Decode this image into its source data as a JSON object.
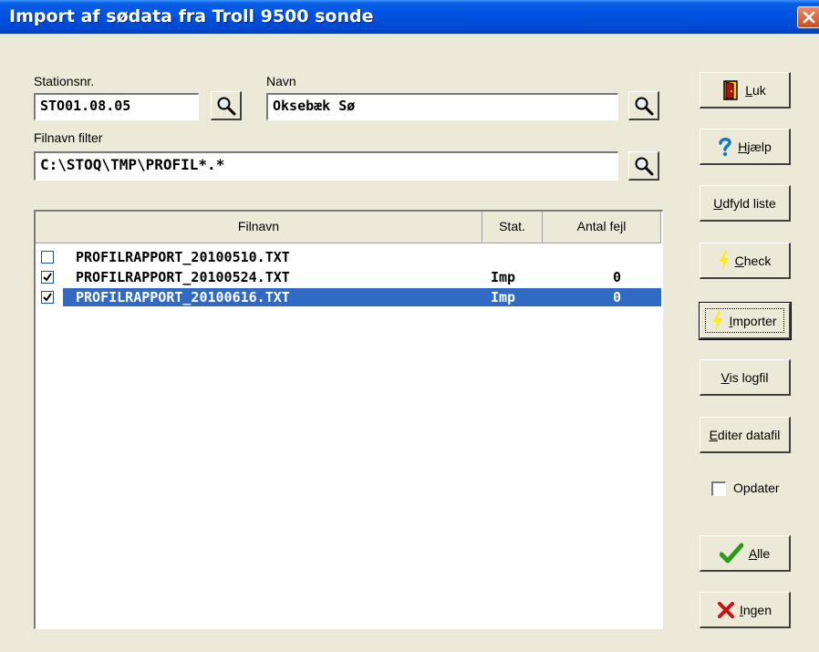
{
  "window": {
    "title": "Import af sødata fra Troll 9500 sonde"
  },
  "station": {
    "label": "Stationsnr.",
    "value": "STO01.08.05"
  },
  "name": {
    "label": "Navn",
    "value": "Oksebæk Sø"
  },
  "filter": {
    "label": "Filnavn filter",
    "value": "C:\\STOQ\\TMP\\PROFIL*.*"
  },
  "list": {
    "headers": [
      "Filnavn",
      "Stat.",
      "Antal fejl"
    ],
    "rows": [
      {
        "checked": false,
        "selected": false,
        "file": "PROFILRAPPORT_20100510.TXT",
        "stat": "",
        "errors": ""
      },
      {
        "checked": true,
        "selected": false,
        "file": "PROFILRAPPORT_20100524.TXT",
        "stat": "Imp",
        "errors": "0"
      },
      {
        "checked": true,
        "selected": true,
        "file": "PROFILRAPPORT_20100616.TXT",
        "stat": "Imp",
        "errors": "0"
      }
    ]
  },
  "buttons": {
    "luk": {
      "underline": "L",
      "rest": "uk",
      "icon": "door-icon"
    },
    "hjaelp": {
      "underline": "H",
      "rest": "jælp",
      "icon": "question-icon"
    },
    "udfyld": {
      "underline": "U",
      "rest": "dfyld liste"
    },
    "check": {
      "underline": "C",
      "rest": "heck",
      "icon": "lightning-icon"
    },
    "importer": {
      "underline": "I",
      "rest": "mporter",
      "icon": "lightning-icon"
    },
    "vislog": {
      "underline": "V",
      "rest": "is logfil"
    },
    "editer": {
      "underline": "E",
      "rest": "diter datafil"
    },
    "alle": {
      "underline": "A",
      "rest": "lle",
      "icon": "checkmark-icon"
    },
    "ingen": {
      "underline": "I",
      "rest": "ngen",
      "icon": "x-icon"
    }
  },
  "opdater": {
    "label": "Opdater",
    "checked": false
  },
  "colors": {
    "title_bar": "#0054e3",
    "selection": "#316ac5",
    "face": "#ece9d8"
  }
}
